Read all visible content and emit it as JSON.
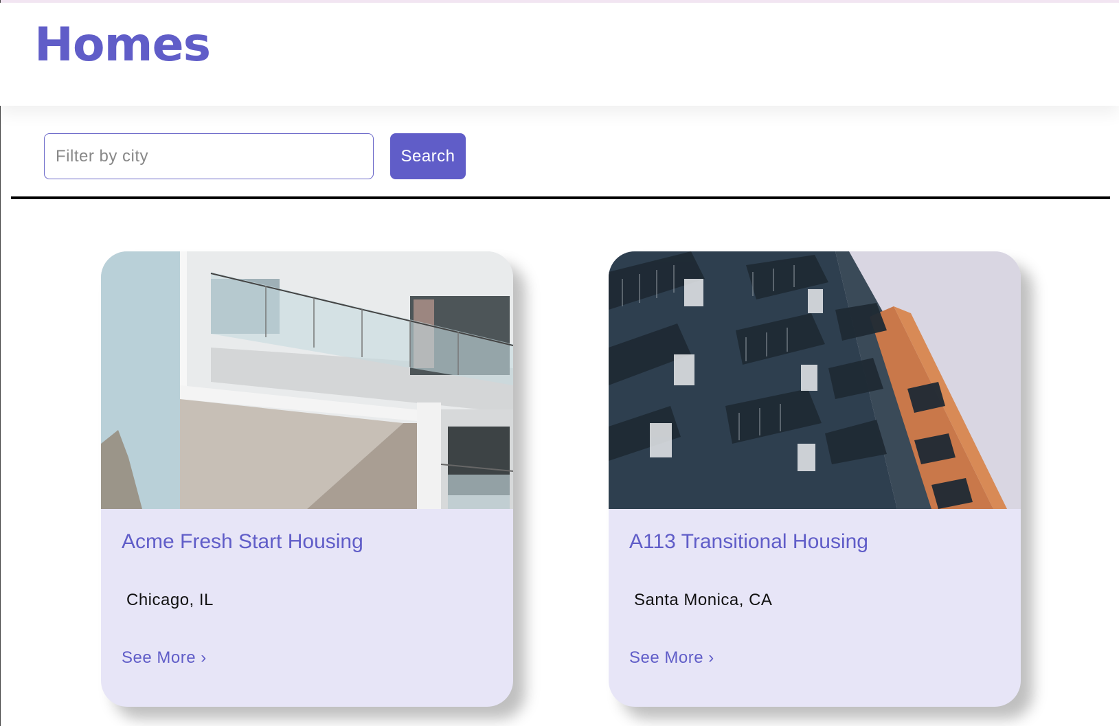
{
  "header": {
    "title": "Homes"
  },
  "search": {
    "placeholder": "Filter by city",
    "button_label": "Search"
  },
  "colors": {
    "accent": "#605dc8",
    "card_background": "#e7e5f7"
  },
  "listings": [
    {
      "title": "Acme Fresh Start Housing",
      "location": "Chicago, IL",
      "link_label": "See More ›",
      "image": "white-apartment-building-photo"
    },
    {
      "title": "A113 Transitional Housing",
      "location": "Santa Monica, CA",
      "link_label": "See More ›",
      "image": "blue-and-orange-apartment-building-photo"
    }
  ]
}
